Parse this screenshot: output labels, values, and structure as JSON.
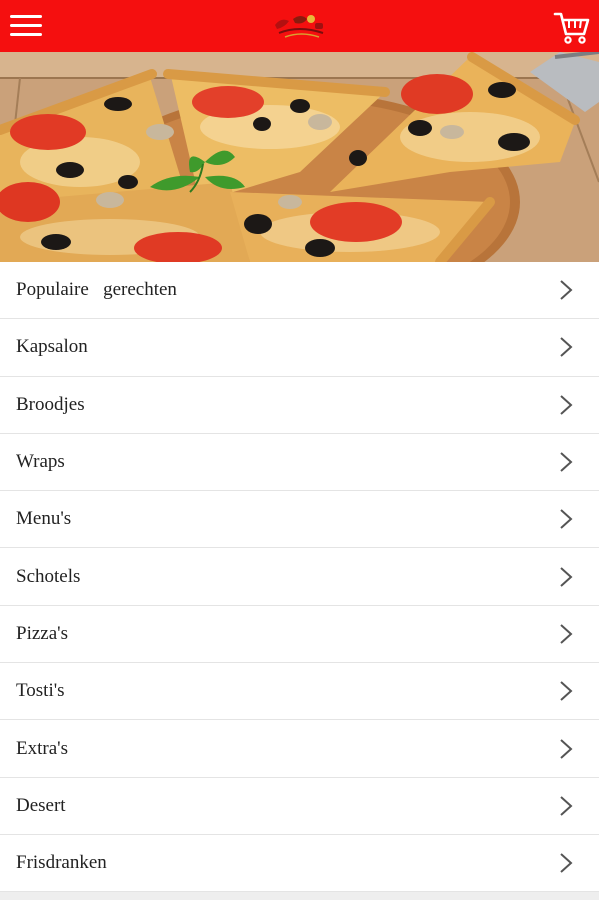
{
  "header": {
    "menu_icon": "hamburger-menu-icon",
    "logo_icon": "restaurant-logo",
    "cart_icon": "shopping-cart-icon",
    "bar_color": "#f50f0f"
  },
  "hero": {
    "image": "pizza-photo"
  },
  "categories": [
    {
      "label": "Populaire   gerechten"
    },
    {
      "label": "Kapsalon"
    },
    {
      "label": "Broodjes"
    },
    {
      "label": "Wraps"
    },
    {
      "label": "Menu's"
    },
    {
      "label": "Schotels"
    },
    {
      "label": "Pizza's"
    },
    {
      "label": "Tosti's"
    },
    {
      "label": "Extra's"
    },
    {
      "label": "Desert"
    },
    {
      "label": "Frisdranken"
    }
  ]
}
